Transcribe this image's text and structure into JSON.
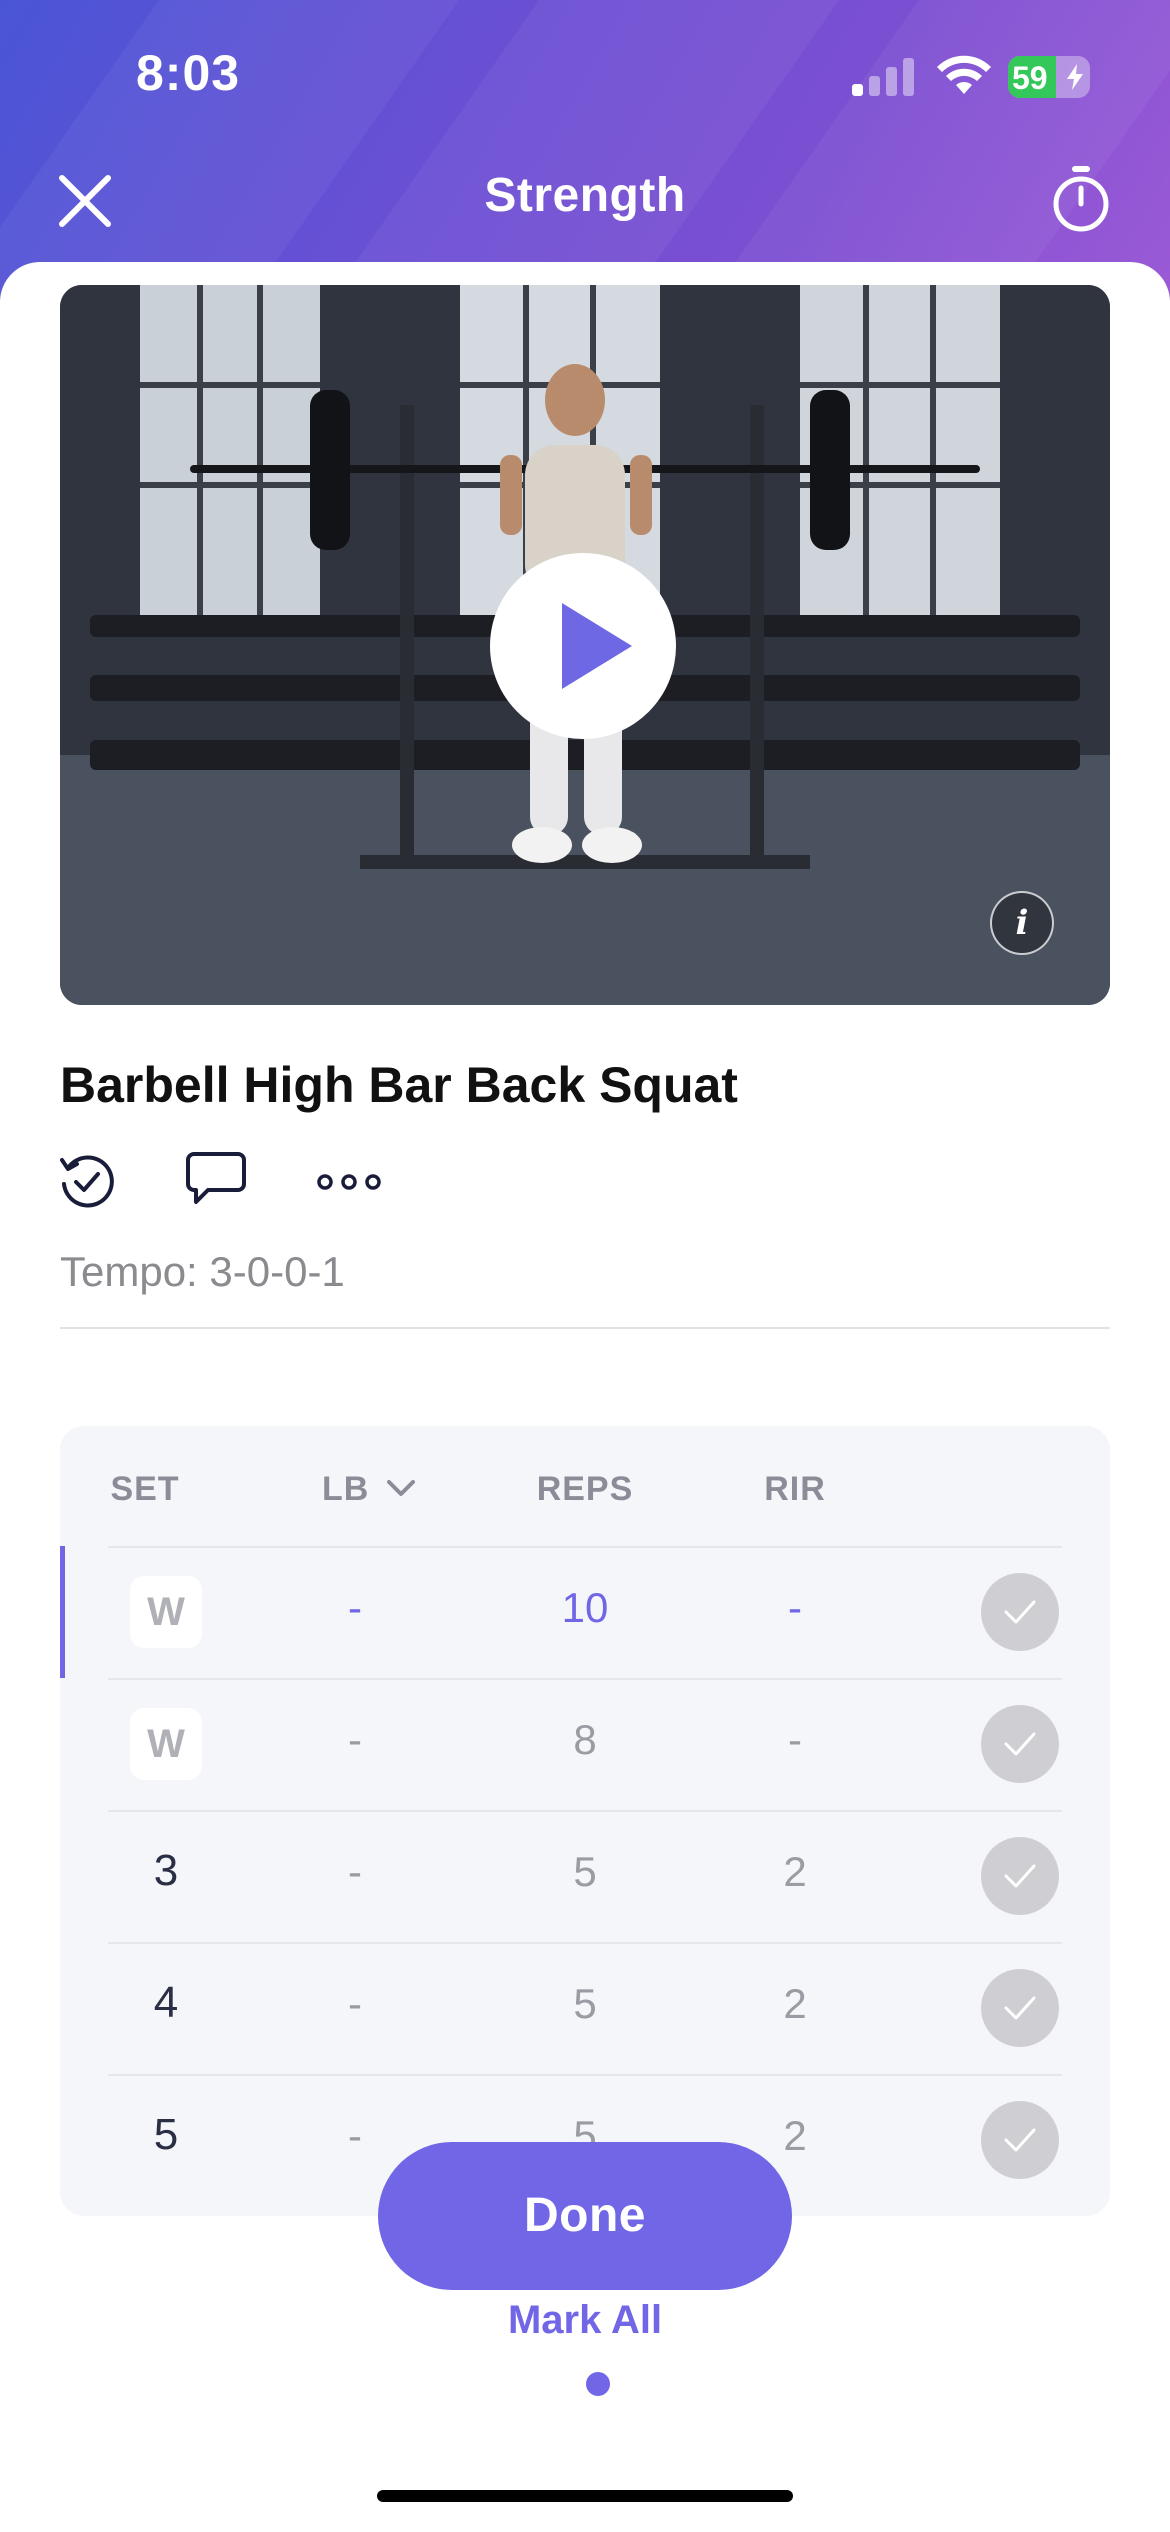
{
  "status_bar": {
    "time": "8:03",
    "battery": "59"
  },
  "nav": {
    "title": "Strength"
  },
  "video": {
    "info_label": "i"
  },
  "exercise": {
    "title": "Barbell High Bar Back Squat",
    "tempo": "Tempo: 3-0-0-1"
  },
  "table": {
    "headers": {
      "set": "SET",
      "weight": "LB",
      "reps": "REPS",
      "rir": "RIR"
    },
    "rows": [
      {
        "set": "W",
        "weight": "-",
        "reps": "10",
        "rir": "-"
      },
      {
        "set": "W",
        "weight": "-",
        "reps": "8",
        "rir": "-"
      },
      {
        "set": "3",
        "weight": "-",
        "reps": "5",
        "rir": "2"
      },
      {
        "set": "4",
        "weight": "-",
        "reps": "5",
        "rir": "2"
      },
      {
        "set": "5",
        "weight": "-",
        "reps": "5",
        "rir": "2"
      }
    ]
  },
  "actions": {
    "done": "Done",
    "mark_all": "Mark All"
  },
  "colors": {
    "accent": "#7066e6",
    "header_gradient_start": "#4a55d6",
    "header_gradient_end": "#9b5ad6",
    "battery": "#34c759"
  }
}
